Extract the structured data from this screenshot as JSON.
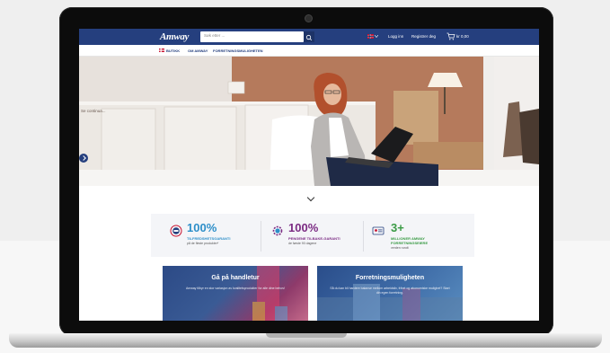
{
  "site": {
    "logo": "Amway",
    "search_placeholder": "Søk etter ...",
    "header_links": [
      "Logg inn",
      "Registrer deg"
    ],
    "cart_total": "kr 0,00",
    "nav": [
      "BUTIKK",
      "OM AMWAY",
      "FORRETNINGSMULIGHETEN"
    ],
    "hero_text": "Se continua...",
    "colors": {
      "brand": "#253f7e",
      "teal": "#2e8fc9",
      "purple": "#7b2b83",
      "green": "#3a9b45"
    }
  },
  "features": [
    {
      "big": "100%",
      "line1": "TILFREDSHETSGARANTI",
      "line2": "på de fleste produkter*",
      "color": "#2e8fc9",
      "icon": "badge-icon"
    },
    {
      "big": "100%",
      "line1": "PENGENE TILBAKE-GARANTI",
      "line2": "de første 90 dagene",
      "color": "#7b2b83",
      "icon": "gear-icon"
    },
    {
      "big": "3+",
      "line1": "MILLIONER AMWAY",
      "line1b": "FORRETNINGSEIERE",
      "line2": "verden rundt",
      "color": "#3a9b45",
      "icon": "id-card-icon"
    }
  ],
  "cards": [
    {
      "title": "Gå på handletur",
      "text": "Amway tilbyr en stor variasjon av kvalitetsprodukter for alle dine behov!"
    },
    {
      "title": "Forretningsmuligheten",
      "text": "Så du kan bli hardere balanse mellom arbeidsliv, frihet og økonomiske mulighet? Start din egen forretning."
    }
  ]
}
